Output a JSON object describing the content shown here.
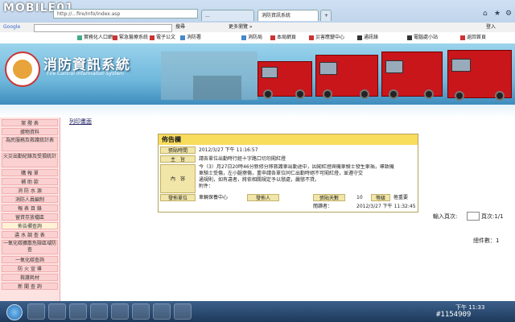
{
  "watermark_top": "MOBILE01",
  "browser": {
    "address": "http://...fire/Info/Index.asp",
    "tabs": [
      "...",
      "消防資訊系統",
      "+"
    ],
    "search_label": "Google",
    "search_button": "搜尋",
    "more_label": "更多瀏覽 »",
    "login": "登入"
  },
  "links": [
    {
      "label": "實務化人口網",
      "color": "#4a8"
    },
    {
      "label": "緊急醫療系統",
      "color": "#c33"
    },
    {
      "label": "電子公文",
      "color": "#c33"
    },
    {
      "label": "消防署",
      "color": "#48c"
    },
    {
      "label": "消防局",
      "color": "#48c"
    },
    {
      "label": "本局網頁",
      "color": "#c33"
    },
    {
      "label": "災害應變中心",
      "color": "#c33"
    },
    {
      "label": "通訊錄",
      "color": "#333"
    },
    {
      "label": "電腦處小站",
      "color": "#333"
    },
    {
      "label": "返回首頁",
      "color": "#c33"
    }
  ],
  "banner": {
    "title": "消防資訊系統",
    "subtitle": "Fire Control Information System"
  },
  "sidebar": [
    "案 撥 表",
    "據物資料",
    "為民服務及救護統計表",
    "火災出勤紀錄及受損統計",
    "購 報 單",
    "補 助 款",
    "消 防 水 源",
    "消防人員編制",
    "報 表 目 錄",
    "留資存放檔區",
    "佈告欄查詢",
    "違 水 調 查 表",
    "一氧化碳擴散危險區域防查",
    "一氧化碳查詢",
    "防 火 宣 導",
    "救護耗材",
    "新 聞 查 詢"
  ],
  "sidebar_selected": 10,
  "print_link": "列印畫面",
  "notice": {
    "header": "佈告欄",
    "time_label": "張貼時間",
    "time_value": "2012/3/27 下午 11:16:57",
    "subject_label": "主　旨",
    "subject_value": "請各單位出勤時行經十字路口切勿闖紅燈",
    "content_label": "內　容",
    "content_lines": [
      "今（3）月27日20時46分新修分隊救護車出勤途中，因闖紅燈與機車騎士發生車禍，導致機",
      "車騎士受傷，左小腿擦傷，重申請各單位同仁出勤時絕不可闖紅燈，並遵守交",
      "通規則，如有違者，將依相關規定予以懲處，嚴懲不貸。",
      "附件："
    ],
    "unit_label": "發佈單位",
    "unit_value": "車輛保養中心",
    "poster_label": "發佈人",
    "poster_value": "",
    "days_label": "張貼天數",
    "days_value": "10",
    "level_label": "等級",
    "level_value": "極重要",
    "read_label": "閱讀者：",
    "read_value": "2012/3/27 下午 11:32:45"
  },
  "pager": {
    "label": "輸入頁次:",
    "page": "頁次:1/1",
    "total": "總件數：1"
  },
  "taskbar": {
    "clock": "下午 11:33",
    "watermark": "#1154909"
  }
}
